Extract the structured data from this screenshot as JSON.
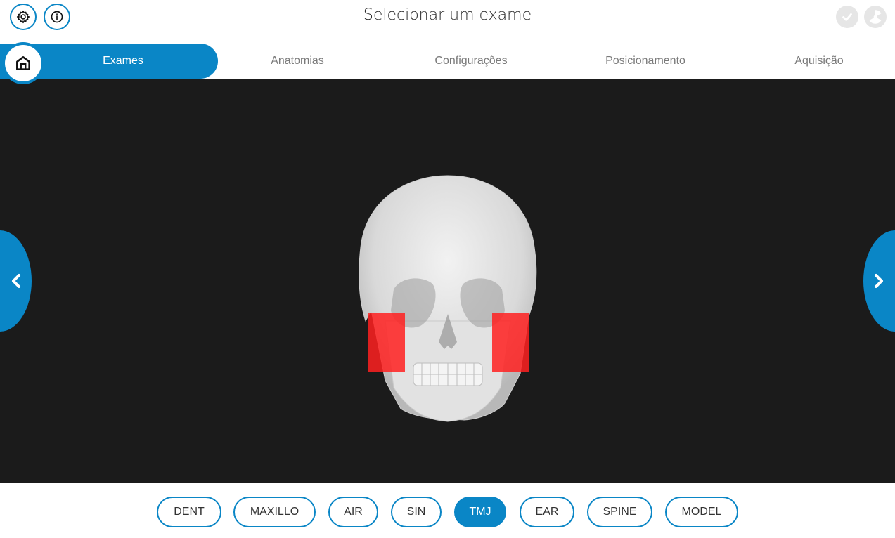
{
  "header": {
    "title": "Selecionar um exame",
    "settings_icon": "gear-icon",
    "info_icon": "info-icon",
    "status_icons": [
      "check-circle-icon",
      "radiation-icon"
    ]
  },
  "tabs": [
    {
      "label": "Exames",
      "active": true
    },
    {
      "label": "Anatomias",
      "active": false
    },
    {
      "label": "Configurações",
      "active": false
    },
    {
      "label": "Posicionamento",
      "active": false
    },
    {
      "label": "Aquisição",
      "active": false
    }
  ],
  "exam_types": [
    {
      "label": "DENT",
      "active": false
    },
    {
      "label": "MAXILLO",
      "active": false
    },
    {
      "label": "AIR",
      "active": false
    },
    {
      "label": "SIN",
      "active": false
    },
    {
      "label": "TMJ",
      "active": true
    },
    {
      "label": "EAR",
      "active": false
    },
    {
      "label": "SPINE",
      "active": false
    },
    {
      "label": "MODEL",
      "active": false
    }
  ],
  "colors": {
    "accent": "#0a86c6",
    "viewer_bg": "#1b1b1b",
    "highlight": "#ff2020"
  }
}
